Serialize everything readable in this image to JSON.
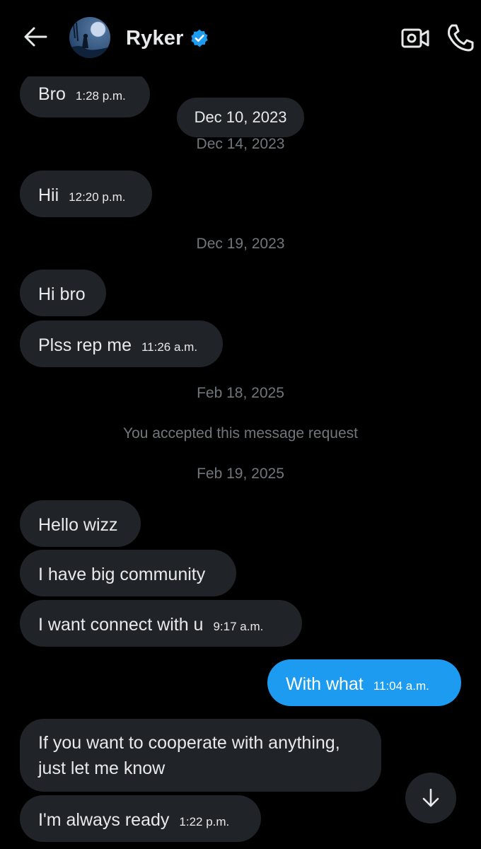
{
  "header": {
    "contact_name": "Ryker",
    "icons": {
      "back": "arrow-left-icon",
      "verified": "verified-badge-icon",
      "video": "video-camera-icon",
      "call": "phone-icon"
    },
    "colors": {
      "accent": "#1d9bf0",
      "background": "#000000",
      "bubble": "#202327",
      "muted_text": "#71767b"
    }
  },
  "sticky_date": "Dec 10, 2023",
  "messages": [
    {
      "text": "Bro",
      "time": "1:28 p.m."
    },
    {
      "text": "Hii",
      "time": "12:20 p.m."
    },
    {
      "text": "Hi bro"
    },
    {
      "text": "Plss rep me",
      "time": "11:26 a.m."
    },
    {
      "text": "Hello wizz"
    },
    {
      "text": "I have big community"
    },
    {
      "text": "I want connect with u",
      "time": "9:17 a.m."
    },
    {
      "text": "With what",
      "time": "11:04 a.m.",
      "sent": true
    },
    {
      "text": "If you want to cooperate with anything, just let me know"
    },
    {
      "text": "I'm always ready",
      "time": "1:22 p.m."
    }
  ],
  "dates": [
    "Dec 14, 2023",
    "Dec 19, 2023",
    "Feb 18, 2025",
    "Feb 19, 2025"
  ],
  "system_note": "You accepted this message request",
  "scroll_down_icon": "arrow-down-icon"
}
